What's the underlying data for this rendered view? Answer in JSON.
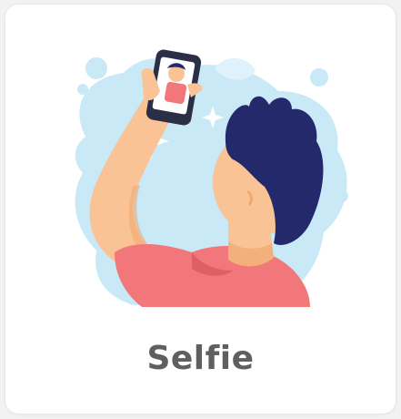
{
  "card": {
    "label": "Selfie",
    "illustration_icon": "selfie-illustration",
    "label_color": "#5f5f5f"
  },
  "colors": {
    "background_blob": "#c9e9f7",
    "sparkle": "#ffffff",
    "skin": "#f9c395",
    "skin_shadow": "#f2a86f",
    "hair": "#23296b",
    "shirt": "#f2777a",
    "phone": "#2b2f45",
    "screen": "#ffffff"
  }
}
